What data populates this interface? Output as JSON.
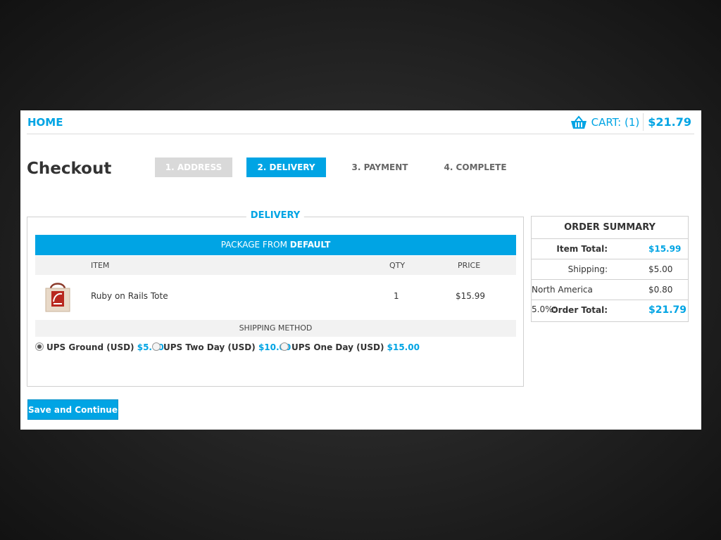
{
  "header": {
    "home_label": "HOME",
    "cart_label": "CART: (1)",
    "cart_total": "$21.79",
    "cart_icon": "basket-icon"
  },
  "checkout": {
    "title": "Checkout",
    "steps": [
      {
        "label": "1. ADDRESS",
        "state": "done"
      },
      {
        "label": "2. DELIVERY",
        "state": "active"
      },
      {
        "label": "3. PAYMENT",
        "state": "todo"
      },
      {
        "label": "4. COMPLETE",
        "state": "todo"
      }
    ]
  },
  "delivery": {
    "legend": "DELIVERY",
    "package_prefix": "PACKAGE FROM ",
    "package_name": "DEFAULT",
    "columns": {
      "item": "ITEM",
      "qty": "QTY",
      "price": "PRICE"
    },
    "items": [
      {
        "name": "Ruby on Rails Tote",
        "qty": "1",
        "price": "$15.99",
        "image_icon": "rails-tote-bag-icon"
      }
    ],
    "shipping_header": "SHIPPING METHOD",
    "shipping_options": [
      {
        "label": "UPS Ground (USD)",
        "price": "$5.00",
        "selected": true
      },
      {
        "label": "UPS Two Day (USD)",
        "price": "$10.00",
        "selected": false
      },
      {
        "label": "UPS One Day (USD)",
        "price": "$15.00",
        "selected": false
      }
    ]
  },
  "summary": {
    "title": "ORDER SUMMARY",
    "rows": [
      {
        "label": "Item Total:",
        "value": "$15.99"
      },
      {
        "label": "Shipping:",
        "value": "$5.00"
      },
      {
        "label": "North America 5.0%:",
        "value": "$0.80"
      },
      {
        "label": "Order Total:",
        "value": "$21.79"
      }
    ]
  },
  "actions": {
    "save_label": "Save and Continue"
  },
  "colors": {
    "accent": "#00a4e4",
    "step_done": "#d9d9d9"
  }
}
